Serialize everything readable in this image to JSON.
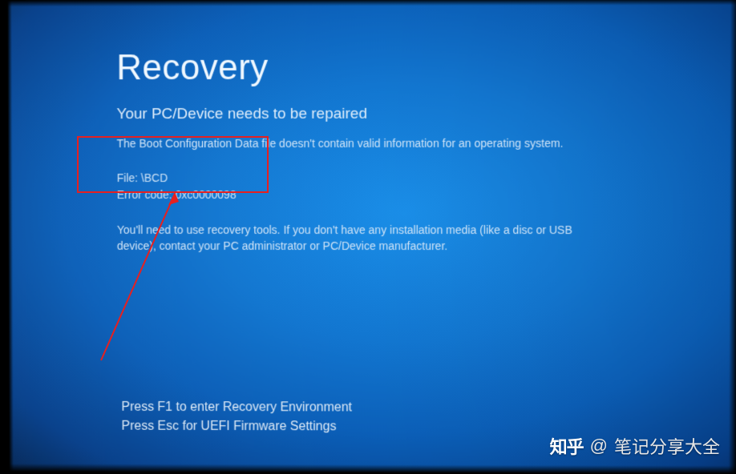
{
  "recovery": {
    "title": "Recovery",
    "subtitle": "Your PC/Device needs to be repaired",
    "description": "The Boot Configuration Data file doesn't contain valid information for an operating system.",
    "file_label": "File: ",
    "file_value": "\\BCD",
    "error_code_label": "Error code: ",
    "error_code_value": "0xc0000098",
    "instructions": "You'll need to use recovery tools. If you don't have any installation media (like a disc or USB device), contact your PC administrator or PC/Device manufacturer.",
    "action_f1": "Press F1 to enter Recovery Environment",
    "action_esc": "Press Esc for UEFI Firmware Settings"
  },
  "watermark": {
    "logo": "知乎",
    "at": "@",
    "user": "笔记分享大全"
  }
}
